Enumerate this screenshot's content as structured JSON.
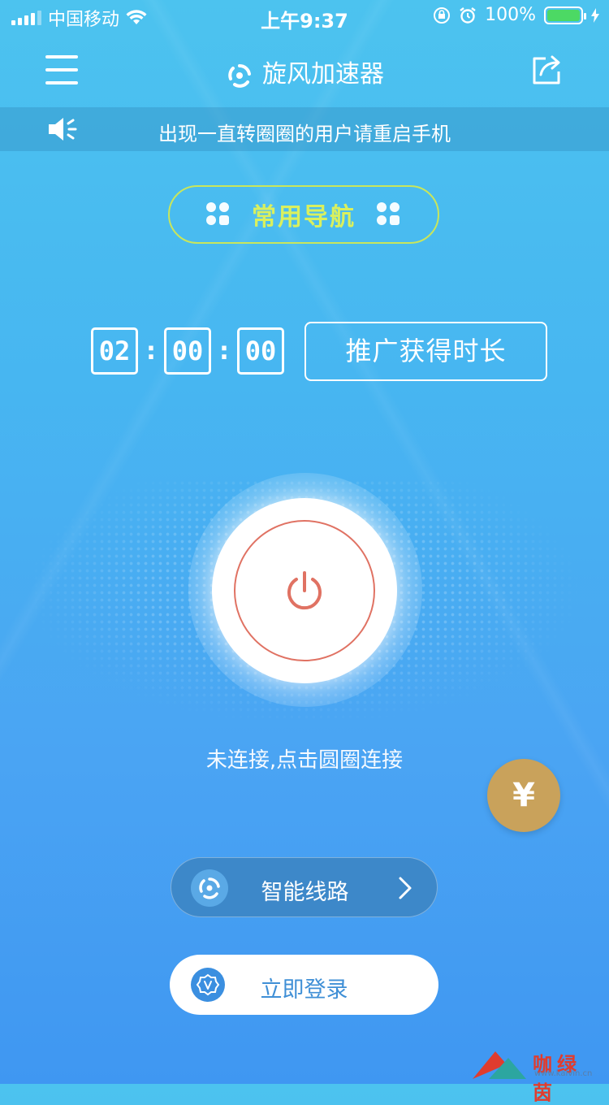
{
  "status_bar": {
    "carrier": "中国移动",
    "time": "上午9:37",
    "battery_percent": "100%",
    "battery_level": 1.0
  },
  "nav": {
    "title": "旋风加速器",
    "menu_icon": "hamburger-icon",
    "share_icon": "share-icon"
  },
  "notice": {
    "text": "出现一直转圈圈的用户请重启手机",
    "icon": "speaker-icon"
  },
  "common_nav": {
    "label": "常用导航"
  },
  "timer": {
    "hours": "02",
    "minutes": "00",
    "seconds": "00",
    "separator": ":"
  },
  "promo_button": {
    "label": "推广获得时长"
  },
  "connection": {
    "status_text": "未连接,点击圆圈连接",
    "power_icon": "power-icon"
  },
  "coin_button": {
    "label": "¥"
  },
  "route_button": {
    "label": "智能线路"
  },
  "login_button": {
    "label": "立即登录"
  },
  "watermark": {
    "text": "咖绿茵",
    "url": "www.kalvin.cn"
  },
  "colors": {
    "bg_top": "#4cc3ef",
    "bg_bottom": "#3f97f2",
    "accent_green": "#d9f05e",
    "power_red": "#e07263",
    "coin_gold": "#c9a25b"
  }
}
